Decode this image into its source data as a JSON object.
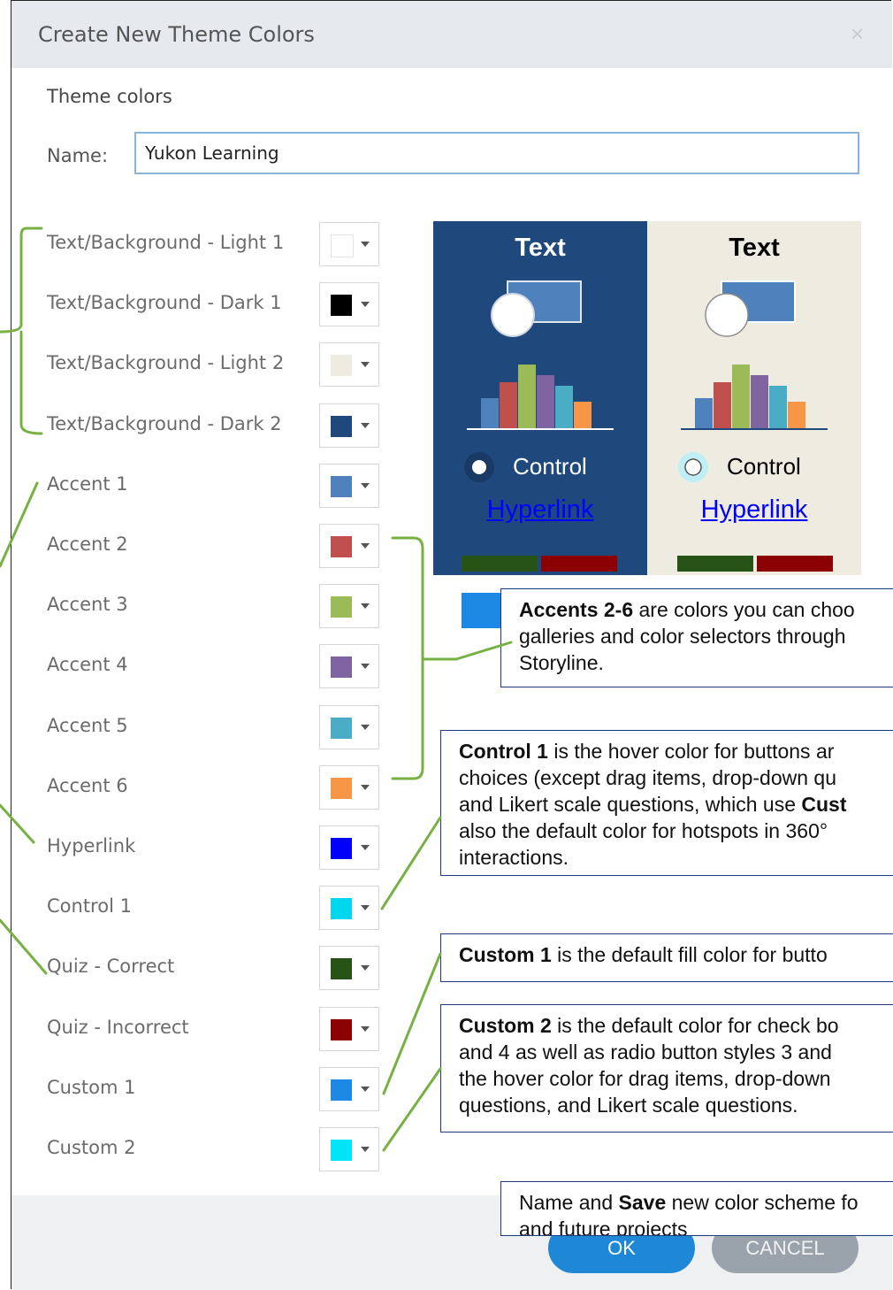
{
  "dialog": {
    "title": "Create New Theme Colors",
    "close_glyph": "×",
    "section_title": "Theme colors",
    "name_label": "Name:",
    "name_value": "Yukon Learning"
  },
  "rows": [
    {
      "label": "Text/Background - Light 1",
      "color": "#ffffff"
    },
    {
      "label": "Text/Background - Dark 1",
      "color": "#000000"
    },
    {
      "label": "Text/Background - Light 2",
      "color": "#eeece1"
    },
    {
      "label": "Text/Background - Dark 2",
      "color": "#1f497d"
    },
    {
      "label": "Accent 1",
      "color": "#4f81bd"
    },
    {
      "label": "Accent 2",
      "color": "#c0504d"
    },
    {
      "label": "Accent 3",
      "color": "#9bbb59"
    },
    {
      "label": "Accent 4",
      "color": "#8064a2"
    },
    {
      "label": "Accent 5",
      "color": "#4bacc6"
    },
    {
      "label": "Accent 6",
      "color": "#f79646"
    },
    {
      "label": "Hyperlink",
      "color": "#0000ff"
    },
    {
      "label": "Control 1",
      "color": "#00d7ef"
    },
    {
      "label": "Quiz - Correct",
      "color": "#275317"
    },
    {
      "label": "Quiz - Incorrect",
      "color": "#8b0000"
    },
    {
      "label": "Custom 1",
      "color": "#1e88e5"
    },
    {
      "label": "Custom 2",
      "color": "#00e5f5"
    }
  ],
  "preview": {
    "dark": {
      "text": "Text",
      "control": "Control",
      "hyperlink": "Hyperlink",
      "background": "#1f497d",
      "text_color": "#ffffff"
    },
    "light": {
      "text": "Text",
      "control": "Control",
      "hyperlink": "Hyperlink",
      "background": "#eeece1",
      "text_color": "#000000"
    }
  },
  "buttons": {
    "ok": "OK",
    "cancel": "CANCEL"
  },
  "callouts": {
    "accents": {
      "bold": "Accents 2-6",
      "rest": " are colors you can choo",
      "line2": "galleries and color selectors through",
      "line3": "Storyline."
    },
    "control1": {
      "bold": "Control 1",
      "rest": " is the hover color for buttons ar",
      "line2": "choices (except drag items, drop-down qu",
      "line3": "and Likert scale questions, which use ",
      "line3_bold": "Cust",
      "line4": "also the default color for hotspots in 360°",
      "line5": "interactions."
    },
    "custom1": {
      "bold": "Custom 1",
      "rest": " is the default fill color for butto"
    },
    "custom2": {
      "bold": "Custom 2",
      "rest": " is the default color for check bo",
      "line2": "and 4 as well as radio button styles 3 and",
      "line3": "the hover color for drag items, drop-down",
      "line4": "questions, and Likert scale questions."
    },
    "save": {
      "pre": "Name and ",
      "bold": "Save",
      "rest": " new color scheme fo",
      "line2": "and future projects"
    }
  },
  "annotation_color": "#77b043"
}
